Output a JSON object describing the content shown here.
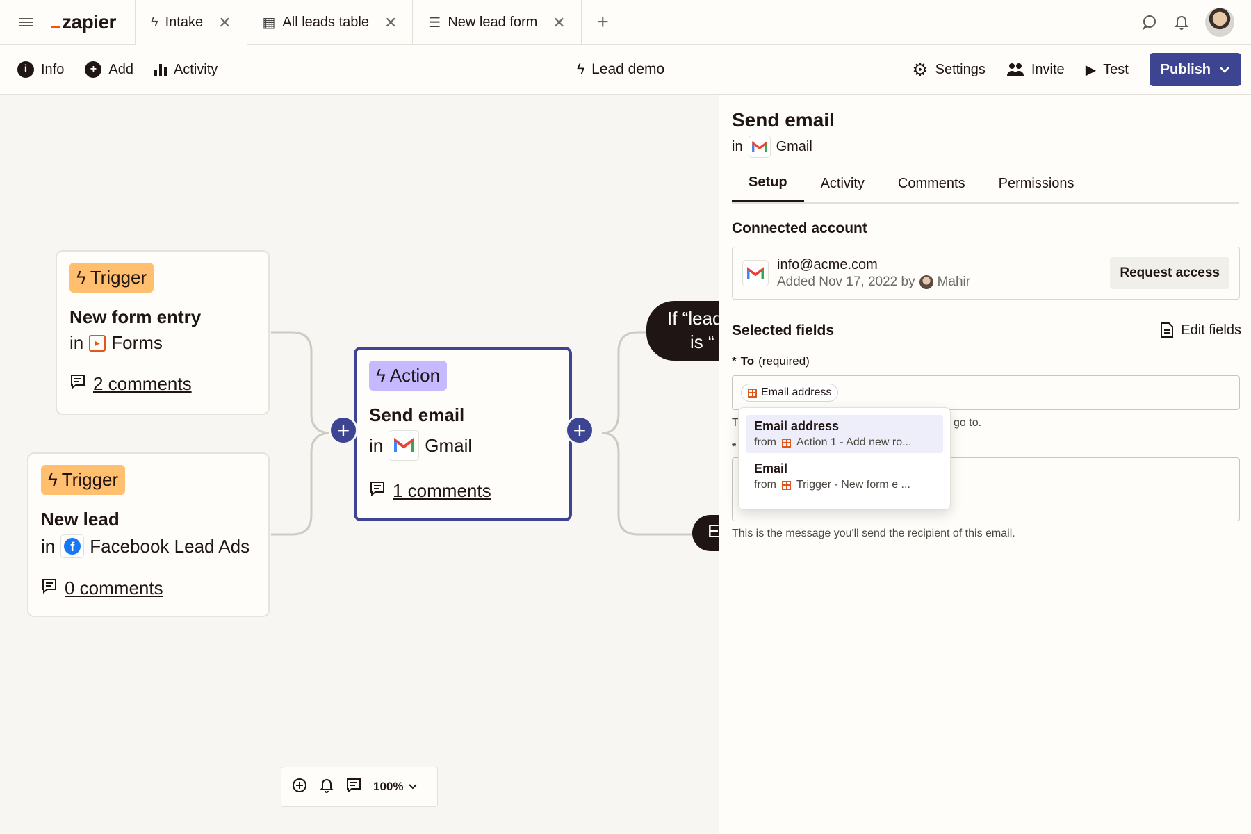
{
  "tabs": [
    {
      "icon": "bolt-icon",
      "label": "Intake"
    },
    {
      "icon": "table-icon",
      "label": "All leads table"
    },
    {
      "icon": "form-icon",
      "label": "New lead form"
    }
  ],
  "toolbar": {
    "info": "Info",
    "add": "Add",
    "activity": "Activity",
    "zap_name": "Lead demo",
    "settings": "Settings",
    "invite": "Invite",
    "test": "Test",
    "publish": "Publish"
  },
  "canvas": {
    "node1": {
      "badge": "Trigger",
      "title": "New form entry",
      "in": "in",
      "app": "Forms",
      "comments": "2 comments"
    },
    "node2": {
      "badge": "Trigger",
      "title": "New lead",
      "in": "in",
      "app": "Facebook Lead Ads",
      "comments": "0 comments"
    },
    "node3": {
      "badge": "Action",
      "title": "Send email",
      "in": "in",
      "app": "Gmail",
      "comments": "1 comments"
    },
    "branch1": "If “lead is “",
    "branch1_line1": "If “lead",
    "branch1_line2": "is “",
    "branch2": "E",
    "zoom": "100%"
  },
  "panel": {
    "title": "Send email",
    "in": "in",
    "app": "Gmail",
    "tabs": [
      "Setup",
      "Activity",
      "Comments",
      "Permissions"
    ],
    "connected_account_label": "Connected account",
    "account_email": "info@acme.com",
    "account_added": "Added Nov 17, 2022 by",
    "account_user": "Mahir",
    "request_access": "Request access",
    "selected_fields_label": "Selected fields",
    "edit_fields": "Edit fields",
    "to_label": "To",
    "to_required": "(required)",
    "to_chip": "Email address",
    "to_helper_start": "T",
    "to_helper_end": "go to.",
    "msg_helper": "This is the message you'll send the recipient of this email."
  },
  "dropdown": {
    "items": [
      {
        "name": "Email address",
        "from": "from",
        "source": "Action 1 - Add new ro..."
      },
      {
        "name": "Email",
        "from": "from",
        "source": "Trigger - New form e ..."
      }
    ]
  },
  "colors": {
    "primary": "#3d4592",
    "trigger": "#ffbf6e",
    "action": "#c5b9ff",
    "brand": "#ff4f00"
  }
}
